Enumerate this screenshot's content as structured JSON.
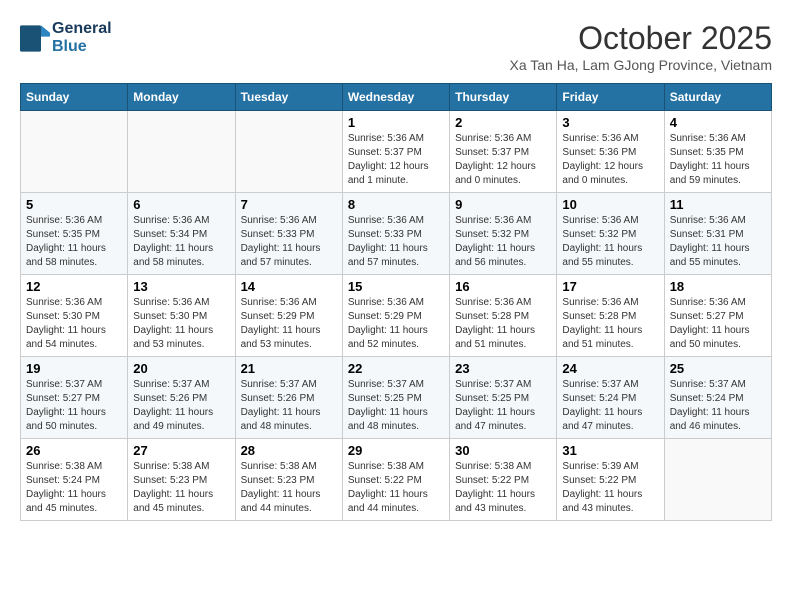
{
  "header": {
    "logo_line1": "General",
    "logo_line2": "Blue",
    "month_title": "October 2025",
    "location": "Xa Tan Ha, Lam GJong Province, Vietnam"
  },
  "days_of_week": [
    "Sunday",
    "Monday",
    "Tuesday",
    "Wednesday",
    "Thursday",
    "Friday",
    "Saturday"
  ],
  "weeks": [
    [
      {
        "day": "",
        "info": ""
      },
      {
        "day": "",
        "info": ""
      },
      {
        "day": "",
        "info": ""
      },
      {
        "day": "1",
        "info": "Sunrise: 5:36 AM\nSunset: 5:37 PM\nDaylight: 12 hours\nand 1 minute."
      },
      {
        "day": "2",
        "info": "Sunrise: 5:36 AM\nSunset: 5:37 PM\nDaylight: 12 hours\nand 0 minutes."
      },
      {
        "day": "3",
        "info": "Sunrise: 5:36 AM\nSunset: 5:36 PM\nDaylight: 12 hours\nand 0 minutes."
      },
      {
        "day": "4",
        "info": "Sunrise: 5:36 AM\nSunset: 5:35 PM\nDaylight: 11 hours\nand 59 minutes."
      }
    ],
    [
      {
        "day": "5",
        "info": "Sunrise: 5:36 AM\nSunset: 5:35 PM\nDaylight: 11 hours\nand 58 minutes."
      },
      {
        "day": "6",
        "info": "Sunrise: 5:36 AM\nSunset: 5:34 PM\nDaylight: 11 hours\nand 58 minutes."
      },
      {
        "day": "7",
        "info": "Sunrise: 5:36 AM\nSunset: 5:33 PM\nDaylight: 11 hours\nand 57 minutes."
      },
      {
        "day": "8",
        "info": "Sunrise: 5:36 AM\nSunset: 5:33 PM\nDaylight: 11 hours\nand 57 minutes."
      },
      {
        "day": "9",
        "info": "Sunrise: 5:36 AM\nSunset: 5:32 PM\nDaylight: 11 hours\nand 56 minutes."
      },
      {
        "day": "10",
        "info": "Sunrise: 5:36 AM\nSunset: 5:32 PM\nDaylight: 11 hours\nand 55 minutes."
      },
      {
        "day": "11",
        "info": "Sunrise: 5:36 AM\nSunset: 5:31 PM\nDaylight: 11 hours\nand 55 minutes."
      }
    ],
    [
      {
        "day": "12",
        "info": "Sunrise: 5:36 AM\nSunset: 5:30 PM\nDaylight: 11 hours\nand 54 minutes."
      },
      {
        "day": "13",
        "info": "Sunrise: 5:36 AM\nSunset: 5:30 PM\nDaylight: 11 hours\nand 53 minutes."
      },
      {
        "day": "14",
        "info": "Sunrise: 5:36 AM\nSunset: 5:29 PM\nDaylight: 11 hours\nand 53 minutes."
      },
      {
        "day": "15",
        "info": "Sunrise: 5:36 AM\nSunset: 5:29 PM\nDaylight: 11 hours\nand 52 minutes."
      },
      {
        "day": "16",
        "info": "Sunrise: 5:36 AM\nSunset: 5:28 PM\nDaylight: 11 hours\nand 51 minutes."
      },
      {
        "day": "17",
        "info": "Sunrise: 5:36 AM\nSunset: 5:28 PM\nDaylight: 11 hours\nand 51 minutes."
      },
      {
        "day": "18",
        "info": "Sunrise: 5:36 AM\nSunset: 5:27 PM\nDaylight: 11 hours\nand 50 minutes."
      }
    ],
    [
      {
        "day": "19",
        "info": "Sunrise: 5:37 AM\nSunset: 5:27 PM\nDaylight: 11 hours\nand 50 minutes."
      },
      {
        "day": "20",
        "info": "Sunrise: 5:37 AM\nSunset: 5:26 PM\nDaylight: 11 hours\nand 49 minutes."
      },
      {
        "day": "21",
        "info": "Sunrise: 5:37 AM\nSunset: 5:26 PM\nDaylight: 11 hours\nand 48 minutes."
      },
      {
        "day": "22",
        "info": "Sunrise: 5:37 AM\nSunset: 5:25 PM\nDaylight: 11 hours\nand 48 minutes."
      },
      {
        "day": "23",
        "info": "Sunrise: 5:37 AM\nSunset: 5:25 PM\nDaylight: 11 hours\nand 47 minutes."
      },
      {
        "day": "24",
        "info": "Sunrise: 5:37 AM\nSunset: 5:24 PM\nDaylight: 11 hours\nand 47 minutes."
      },
      {
        "day": "25",
        "info": "Sunrise: 5:37 AM\nSunset: 5:24 PM\nDaylight: 11 hours\nand 46 minutes."
      }
    ],
    [
      {
        "day": "26",
        "info": "Sunrise: 5:38 AM\nSunset: 5:24 PM\nDaylight: 11 hours\nand 45 minutes."
      },
      {
        "day": "27",
        "info": "Sunrise: 5:38 AM\nSunset: 5:23 PM\nDaylight: 11 hours\nand 45 minutes."
      },
      {
        "day": "28",
        "info": "Sunrise: 5:38 AM\nSunset: 5:23 PM\nDaylight: 11 hours\nand 44 minutes."
      },
      {
        "day": "29",
        "info": "Sunrise: 5:38 AM\nSunset: 5:22 PM\nDaylight: 11 hours\nand 44 minutes."
      },
      {
        "day": "30",
        "info": "Sunrise: 5:38 AM\nSunset: 5:22 PM\nDaylight: 11 hours\nand 43 minutes."
      },
      {
        "day": "31",
        "info": "Sunrise: 5:39 AM\nSunset: 5:22 PM\nDaylight: 11 hours\nand 43 minutes."
      },
      {
        "day": "",
        "info": ""
      }
    ]
  ]
}
